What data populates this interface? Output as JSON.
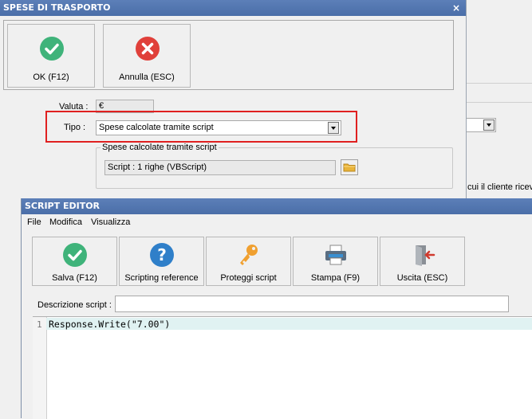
{
  "background_window": {
    "partial_text": "cui il cliente ricev"
  },
  "spese": {
    "title": "SPESE DI TRASPORTO",
    "close_glyph": "×",
    "ok_label": "OK (F12)",
    "cancel_label": "Annulla (ESC)",
    "valuta_label": "Valuta :",
    "valuta_value": "€",
    "tipo_label": "Tipo :",
    "tipo_value": "Spese calcolate tramite script",
    "group_title": "Spese calcolate tramite script",
    "script_summary": "Script : 1 righe (VBScript)"
  },
  "editor": {
    "title": "SCRIPT EDITOR",
    "menu": [
      "File",
      "Modifica",
      "Visualizza"
    ],
    "buttons": [
      {
        "label": "Salva (F12)",
        "icon": "check-icon"
      },
      {
        "label": "Scripting reference",
        "icon": "help-icon"
      },
      {
        "label": "Proteggi script",
        "icon": "key-icon"
      },
      {
        "label": "Stampa (F9)",
        "icon": "printer-icon"
      },
      {
        "label": "Uscita (ESC)",
        "icon": "exit-icon"
      }
    ],
    "description_label": "Descrizione script :",
    "description_value": "",
    "code": {
      "line_numbers": [
        "1"
      ],
      "lines": [
        "Response.Write(\"7.00\")"
      ]
    }
  },
  "colors": {
    "title_bar": "#4a6ea8",
    "ok_green": "#3fb37a",
    "cancel_red": "#e0403a",
    "help_blue": "#2f7fc9",
    "key_orange": "#f0a030",
    "highlight_red": "#e02020",
    "code_line_highlight": "#e0f2f2"
  }
}
